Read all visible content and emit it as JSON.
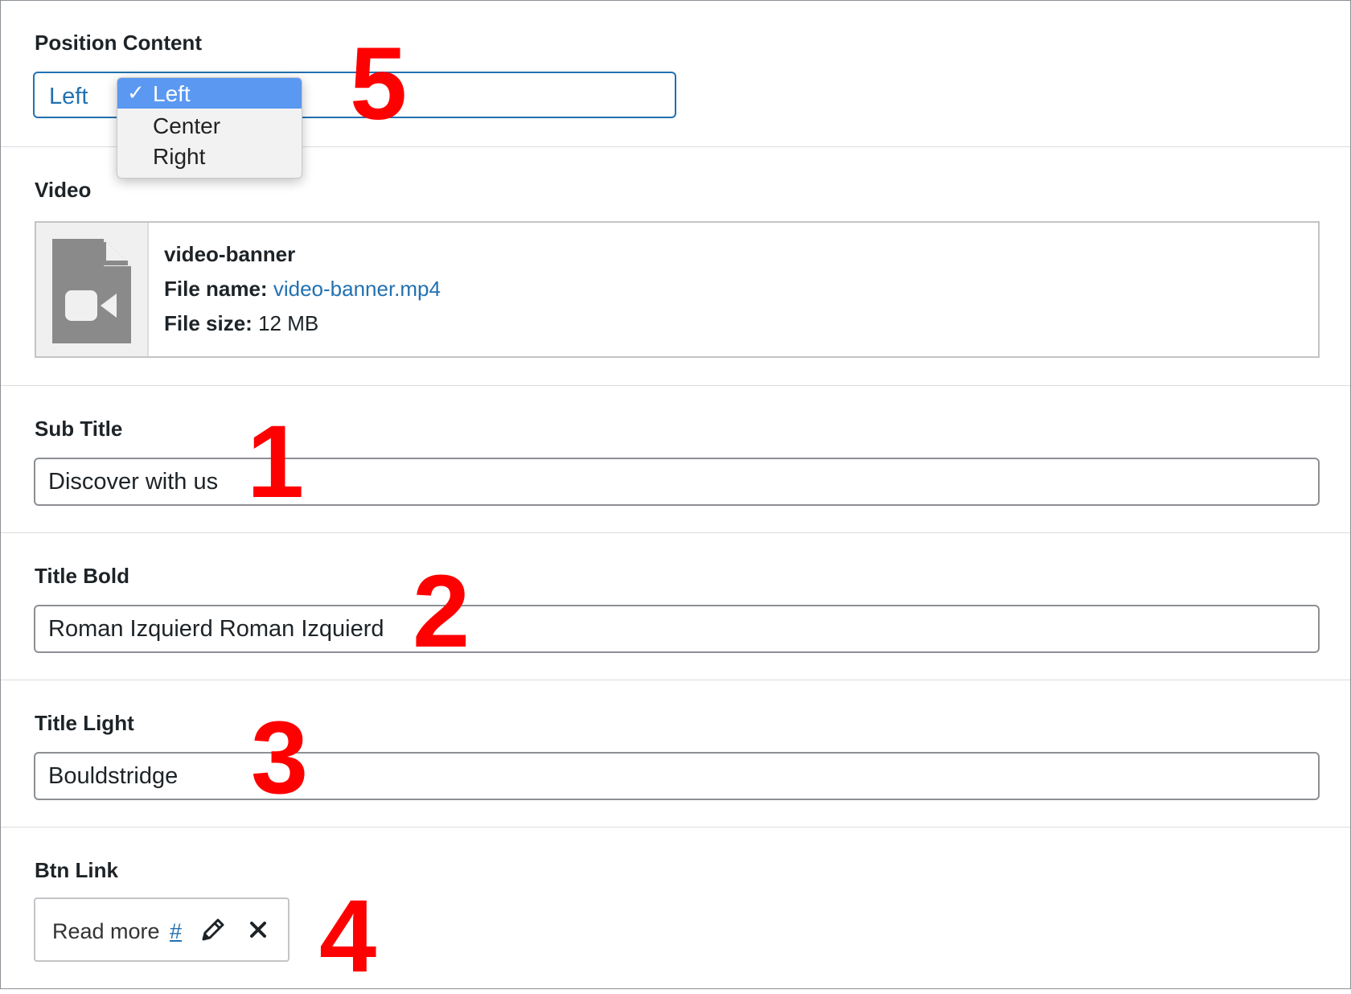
{
  "position_content": {
    "label": "Position Content",
    "selected": "Left",
    "options": [
      {
        "check": "✓",
        "label": "Left",
        "selected": true
      },
      {
        "check": "",
        "label": "Center",
        "selected": false
      },
      {
        "check": "",
        "label": "Right",
        "selected": false
      }
    ]
  },
  "video": {
    "label": "Video",
    "icon": "video-file-icon",
    "title": "video-banner",
    "file_name_label": "File name:",
    "file_name": "video-banner.mp4",
    "file_size_label": "File size:",
    "file_size": "12 MB"
  },
  "sub_title": {
    "label": "Sub Title",
    "value": "Discover with us"
  },
  "title_bold": {
    "label": "Title Bold",
    "value": "Roman Izquierd Roman Izquierd"
  },
  "title_light": {
    "label": "Title Light",
    "value": "Bouldstridge"
  },
  "btn_link": {
    "label": "Btn Link",
    "text": "Read more",
    "url": "#",
    "edit_icon": "pencil-icon",
    "remove_icon": "close-icon"
  },
  "annotations": {
    "n1": "1",
    "n2": "2",
    "n3": "3",
    "n4": "4",
    "n5": "5"
  },
  "colors": {
    "accent": "#2271b1",
    "selected_option": "#5a98f2",
    "annotation": "#ff0000"
  }
}
